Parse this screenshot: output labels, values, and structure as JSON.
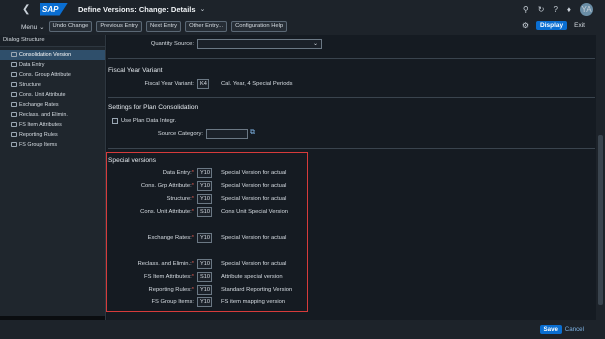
{
  "shell": {
    "title": "Define Versions: Change: Details",
    "logo": "SAP",
    "avatar": "YA"
  },
  "toolbar": {
    "menu": "Menu",
    "buttons": [
      "Undo Change",
      "Previous Entry",
      "Next Entry",
      "Other Entry...",
      "Configuration Help"
    ],
    "display": "Display",
    "exit": "Exit"
  },
  "tree": {
    "header": "Dialog Structure",
    "items": [
      "Consolidation Version",
      "Data Entry",
      "Cons. Group Attribute",
      "Structure",
      "Cons. Unit Attribute",
      "Exchange Rates",
      "Reclass. and Elimin.",
      "FS Item Attributes",
      "Reporting Rules",
      "FS Group Items"
    ]
  },
  "main": {
    "quantity_label": "Quantity Source:",
    "fiscal": {
      "section": "Fiscal Year Variant",
      "label": "Fiscal Year Variant:",
      "value": "K4",
      "desc": "Cal. Year, 4 Special Periods"
    },
    "plan": {
      "section": "Settings for Plan Consolidation",
      "checkbox": "Use Plan Data Integr.",
      "source_label": "Source Category:"
    },
    "special": {
      "section": "Special versions",
      "rows": [
        {
          "label": "Data Entry:",
          "value": "Y10",
          "desc": "Special Version for actual"
        },
        {
          "label": "Cons. Grp Attribute:",
          "value": "Y10",
          "desc": "Special Version for actual"
        },
        {
          "label": "Structure:",
          "value": "Y10",
          "desc": "Special Version for actual"
        },
        {
          "label": "Cons. Unit Attribute:",
          "value": "S10",
          "desc": "Cons Unit Special Version"
        },
        {
          "label": "Exchange Rates:",
          "value": "Y10",
          "desc": "Special Version for actual"
        },
        {
          "label": "Reclass. and Elimin.:",
          "value": "Y10",
          "desc": "Special Version for actual"
        },
        {
          "label": "FS Item Attributes:",
          "value": "S10",
          "desc": "Attribute special version"
        },
        {
          "label": "Reporting Rules:",
          "value": "Y10",
          "desc": "Standard Reporting Version"
        },
        {
          "label": "FS Group Items:",
          "value": "Y10",
          "desc": "FS item mapping version"
        }
      ]
    }
  },
  "footer": {
    "save": "Save",
    "cancel": "Cancel"
  },
  "colors": {
    "accent": "#0a6ed1",
    "highlight_box": "#d63b3b",
    "background": "#151b22"
  }
}
